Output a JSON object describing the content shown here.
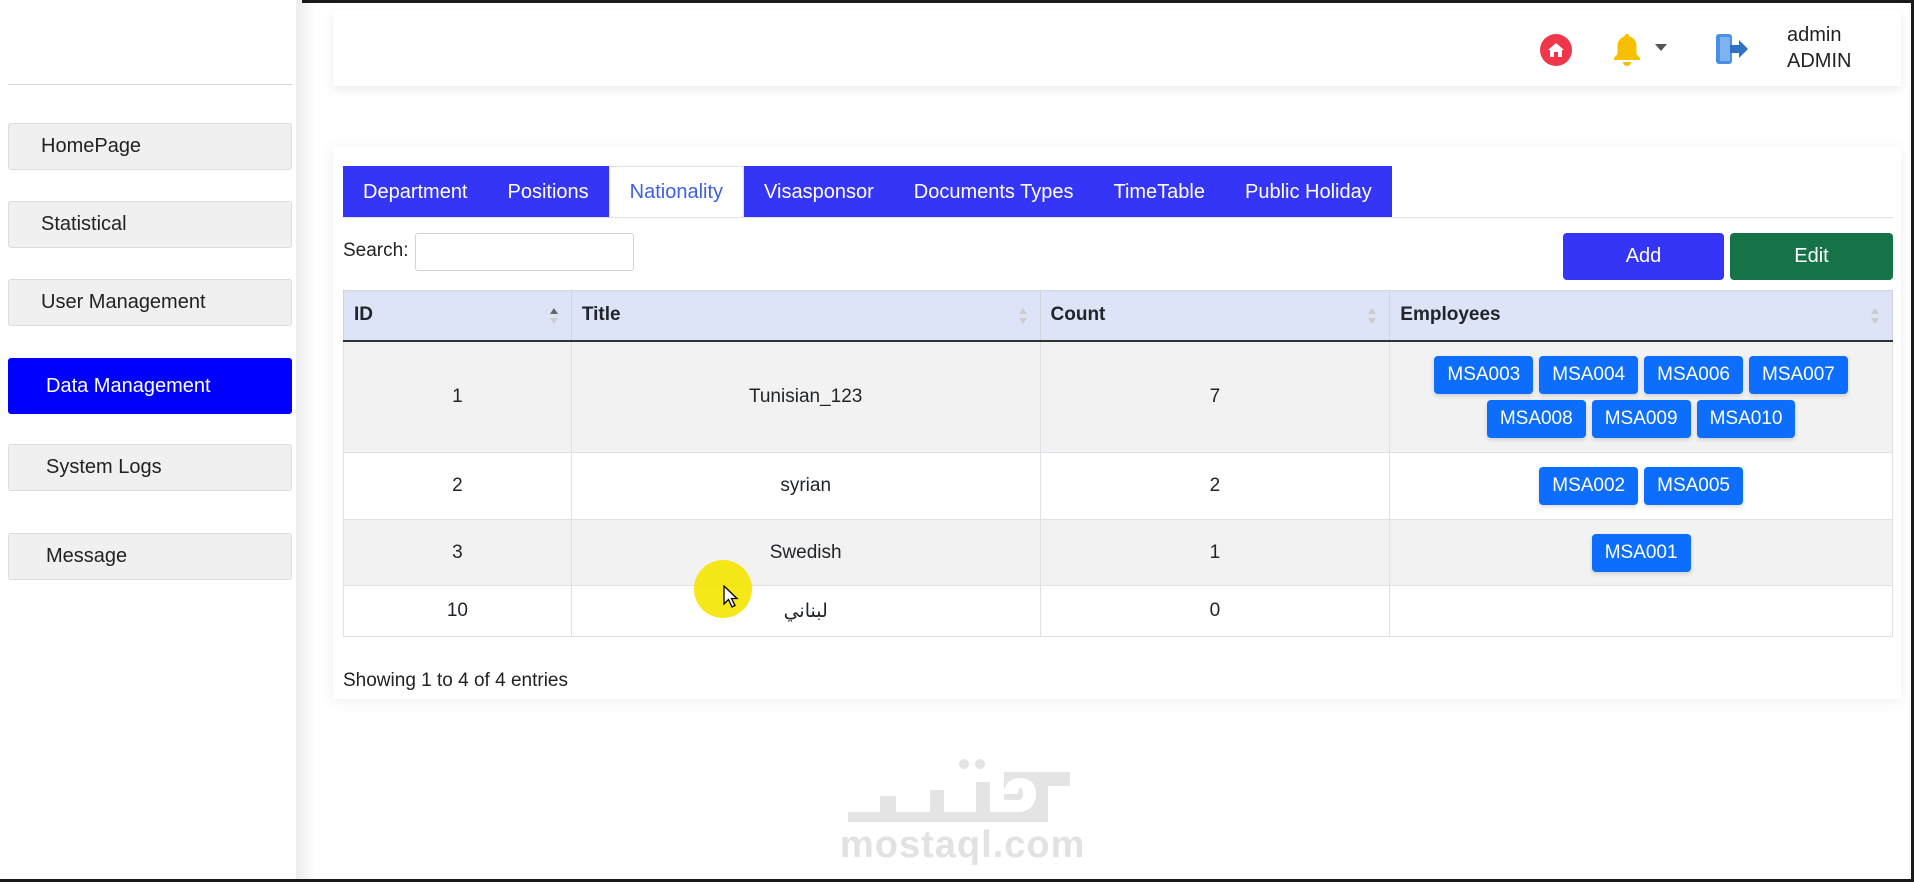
{
  "sidebar": {
    "items": [
      {
        "label": "HomePage"
      },
      {
        "label": "Statistical"
      },
      {
        "label": "User Management"
      },
      {
        "label": "Data Management"
      },
      {
        "label": "System Logs"
      },
      {
        "label": "Message"
      }
    ],
    "active": "Data Management"
  },
  "header": {
    "user_name": "admin",
    "user_role": "ADMIN",
    "icons": [
      "home-icon",
      "bell-icon",
      "caret-down-icon",
      "logout-icon"
    ]
  },
  "tabs": [
    {
      "label": "Department"
    },
    {
      "label": "Positions"
    },
    {
      "label": "Nationality"
    },
    {
      "label": "Visasponsor"
    },
    {
      "label": "Documents Types"
    },
    {
      "label": "TimeTable"
    },
    {
      "label": "Public Holiday"
    }
  ],
  "active_tab": "Nationality",
  "search": {
    "label": "Search:",
    "value": ""
  },
  "toolbar": {
    "add_label": "Add",
    "edit_label": "Edit"
  },
  "table": {
    "columns": [
      "ID",
      "Title",
      "Count",
      "Employees"
    ],
    "rows": [
      {
        "id": "1",
        "title": "Tunisian_123",
        "count": "7",
        "employees": [
          "MSA003",
          "MSA004",
          "MSA006",
          "MSA007",
          "MSA008",
          "MSA009",
          "MSA010"
        ]
      },
      {
        "id": "2",
        "title": "syrian",
        "count": "2",
        "employees": [
          "MSA002",
          "MSA005"
        ]
      },
      {
        "id": "3",
        "title": "Swedish",
        "count": "1",
        "employees": [
          "MSA001"
        ]
      },
      {
        "id": "10",
        "title": "لبناني",
        "count": "0",
        "employees": []
      }
    ]
  },
  "footer": {
    "entries": "Showing 1 to 4 of 4 entries"
  },
  "watermark": {
    "arabic": "مستقل",
    "latin": "mostaql.com"
  },
  "colors": {
    "primary_blue": "#3535f7",
    "active_sidebar": "#0000ff",
    "edit_green": "#157347",
    "employee_button": "#0d6efd",
    "header_row": "#dde4f7"
  }
}
